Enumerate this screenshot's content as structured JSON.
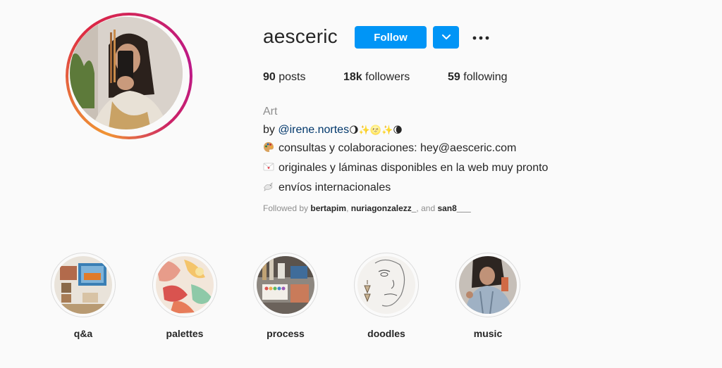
{
  "profile": {
    "username": "aesceric",
    "follow_label": "Follow",
    "stats": {
      "posts_count": "90",
      "posts_label": "posts",
      "followers_count": "18k",
      "followers_label": "followers",
      "following_count": "59",
      "following_label": "following"
    },
    "bio": {
      "category": "Art",
      "by_prefix": "by ",
      "mention": "@irene.nortes",
      "by_emojis": "🌖✨🌝✨🌘",
      "line1": "consultas y colaboraciones: hey@aesceric.com",
      "line2": "originales y láminas disponibles en la web muy pronto",
      "line3": "envíos internacionales"
    },
    "followed_by": {
      "prefix": "Followed by ",
      "users": [
        "bertapim",
        "nuriagonzalezz_",
        "san8___"
      ],
      "sep1": ", ",
      "sep2": ", and "
    }
  },
  "highlights": [
    {
      "label": "q&a"
    },
    {
      "label": "palettes"
    },
    {
      "label": "process"
    },
    {
      "label": "doodles"
    },
    {
      "label": "music"
    }
  ],
  "icons": {
    "dropdown": "chevron-down-icon",
    "more": "more-options-icon",
    "bio1": "palette-emoji-icon",
    "bio2": "love-letter-emoji-icon",
    "bio3": "dove-emoji-icon"
  },
  "colors": {
    "accent": "#0095f6",
    "mention": "#00376b",
    "muted": "#8e8e8e",
    "text": "#262626"
  }
}
